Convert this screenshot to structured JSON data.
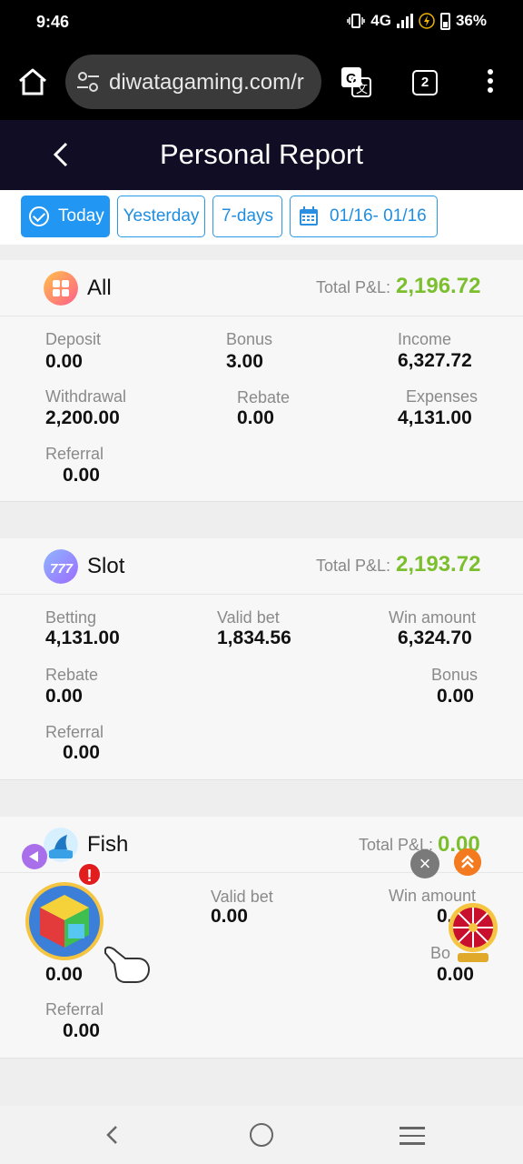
{
  "status": {
    "time": "9:46",
    "network": "4G",
    "battery": "36%"
  },
  "browser": {
    "url": "diwatagaming.com/r",
    "tab_count": "2"
  },
  "header": {
    "title": "Personal Report"
  },
  "filters": {
    "today": "Today",
    "yesterday": "Yesterday",
    "seven_days": "7-days",
    "range": "01/16- 01/16"
  },
  "cards": {
    "all": {
      "title": "All",
      "pl_label": "Total P&L:",
      "pl_value": "2,196.72",
      "deposit_label": "Deposit",
      "deposit": "0.00",
      "bonus_label": "Bonus",
      "bonus": "3.00",
      "income_label": "Income",
      "income": "6,327.72",
      "withdrawal_label": "Withdrawal",
      "withdrawal": "2,200.00",
      "rebate_label": "Rebate",
      "rebate": "0.00",
      "expenses_label": "Expenses",
      "expenses": "4,131.00",
      "referral_label": "Referral",
      "referral": "0.00"
    },
    "slot": {
      "title": "Slot",
      "pl_label": "Total P&L:",
      "pl_value": "2,193.72",
      "betting_label": "Betting",
      "betting": "4,131.00",
      "valid_label": "Valid bet",
      "valid": "1,834.56",
      "win_label": "Win amount",
      "win": "6,324.70",
      "rebate_label": "Rebate",
      "rebate": "0.00",
      "bonus_label": "Bonus",
      "bonus": "0.00",
      "referral_label": "Referral",
      "referral": "0.00"
    },
    "fish": {
      "title": "Fish",
      "pl_label": "Total P&L:",
      "pl_value": "0.00",
      "valid_label": "Valid bet",
      "valid": "0.00",
      "win_label": "Win amount",
      "win": "0.",
      "rebate_value": "0.00",
      "bonus_label": "Bo",
      "bonus": "0.00",
      "referral_label": "Referral",
      "referral": "0.00"
    }
  },
  "floating": {
    "alert": "!",
    "close": "×"
  }
}
